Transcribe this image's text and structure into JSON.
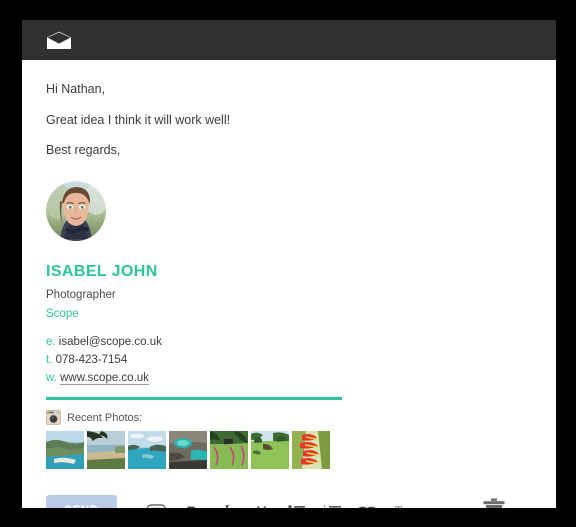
{
  "window": {
    "header_icon": "envelope-open-icon",
    "background_color": "#000000",
    "card_color": "#ffffff",
    "header_color": "#303030",
    "accent_green": "#2ec49b",
    "send_button_color": "#b9cbe8"
  },
  "message": {
    "greeting": "Hi Nathan,",
    "body": "Great idea I think it will work well!",
    "closing": "Best regards,"
  },
  "signature": {
    "avatar_alt": "portrait-photo",
    "name": "ISABEL JOHN",
    "role": "Photographer",
    "company": "Scope",
    "contacts": [
      {
        "key": "e.",
        "value": "isabel@scope.co.uk",
        "link": false
      },
      {
        "key": "t.",
        "value": "078-423-7154",
        "link": false
      },
      {
        "key": "w.",
        "value": "www.scope.co.uk",
        "link": true
      }
    ],
    "recent_photos_label": "Recent Photos:",
    "recent_photos_icon": "instagram-icon",
    "thumbnail_count": 7
  },
  "toolbar": {
    "send_label": "SEND",
    "items": [
      {
        "name": "attach-icon",
        "label": ""
      },
      {
        "name": "bold-icon",
        "label": "B"
      },
      {
        "name": "italic-icon",
        "label": "I"
      },
      {
        "name": "underline-icon",
        "label": "U"
      },
      {
        "name": "bullet-list-icon",
        "label": ""
      },
      {
        "name": "numbered-list-icon",
        "label": ""
      },
      {
        "name": "link-icon",
        "label": ""
      },
      {
        "name": "clear-formatting-icon",
        "label": ""
      }
    ],
    "delete_icon": "trash-icon"
  }
}
